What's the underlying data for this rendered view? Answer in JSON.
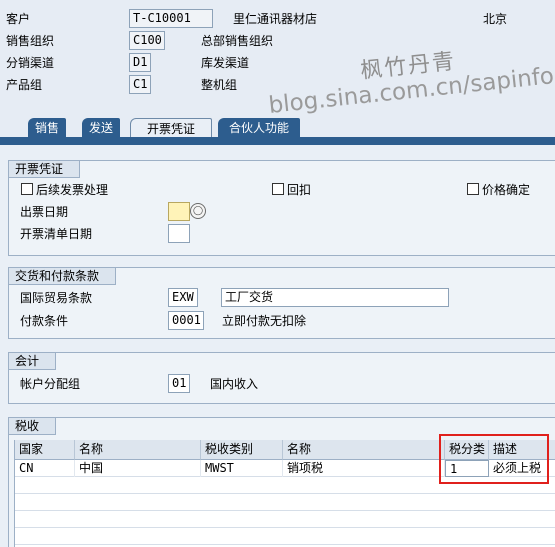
{
  "header": {
    "customer_label": "客户",
    "customer_value": "T-C10001",
    "customer_name": "里仁通讯器材店",
    "customer_city": "北京",
    "sales_org_label": "销售组织",
    "sales_org_value": "C100",
    "sales_org_desc": "总部销售组织",
    "dist_channel_label": "分销渠道",
    "dist_channel_value": "D1",
    "dist_channel_desc": "库发渠道",
    "division_label": "产品组",
    "division_value": "C1",
    "division_desc": "整机组"
  },
  "watermark": {
    "line1": "枫竹丹青",
    "line2": "blog.sina.com.cn/sapinfo"
  },
  "tabs": [
    "销售",
    "发送",
    "开票凭证",
    "合伙人功能"
  ],
  "billing": {
    "title": "开票凭证",
    "subsequent_invoice_label": "后续发票处理",
    "rebate_label": "回扣",
    "price_determination_label": "价格确定",
    "invoice_date_label": "出票日期",
    "invoice_list_date_label": "开票清单日期"
  },
  "delivery": {
    "title": "交货和付款条款",
    "incoterms_label": "国际贸易条款",
    "incoterms_value": "EXW",
    "incoterms_desc": "工厂交货",
    "payment_terms_label": "付款条件",
    "payment_terms_value": "0001",
    "payment_terms_desc": "立即付款无扣除"
  },
  "accounting": {
    "title": "会计",
    "acct_group_label": "帐户分配组",
    "acct_group_value": "01",
    "acct_group_desc": "国内收入"
  },
  "tax": {
    "title": "税收",
    "columns": [
      "国家",
      "名称",
      "税收类别",
      "名称",
      "税分类",
      "描述"
    ],
    "rows": [
      [
        "CN",
        "中国",
        "MWST",
        "销项税",
        "1",
        "必须上税"
      ]
    ]
  },
  "colors": {
    "tab_blue": "#2d5d8e",
    "highlight_red": "#e0201c",
    "required_yellow": "#fff3b8"
  }
}
